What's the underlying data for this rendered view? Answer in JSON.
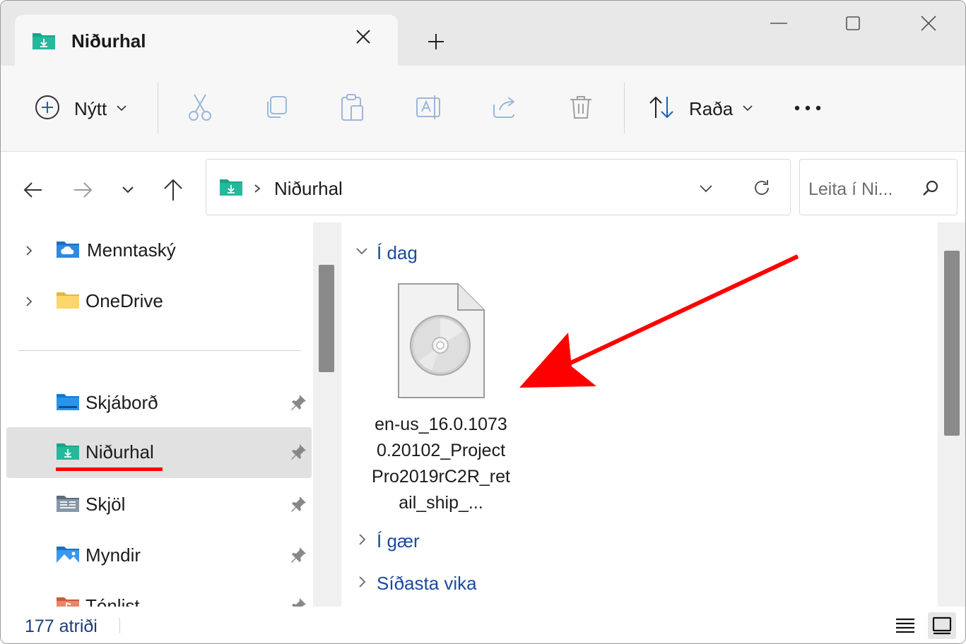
{
  "tab": {
    "title": "Niðurhal",
    "new_tab": "+"
  },
  "window_controls": {
    "minimize": "minimize",
    "maximize": "maximize",
    "close": "close"
  },
  "toolbar": {
    "new_label": "Nýtt",
    "sort_label": "Raða",
    "actions": [
      "cut",
      "copy",
      "paste",
      "rename",
      "share",
      "delete"
    ],
    "more": "•••"
  },
  "address": {
    "path": "Niðurhal",
    "separator": "›"
  },
  "search": {
    "placeholder": "Leita í Ni..."
  },
  "nav": {
    "items": [
      {
        "label": "Menntaský",
        "icon": "cloud-folder-icon",
        "expandable": true
      },
      {
        "label": "OneDrive",
        "icon": "folder-icon",
        "expandable": true
      },
      {
        "label": "Skjáborð",
        "icon": "desktop-folder-icon",
        "pinned": true
      },
      {
        "label": "Niðurhal",
        "icon": "downloads-folder-icon",
        "pinned": true,
        "selected": true
      },
      {
        "label": "Skjöl",
        "icon": "documents-folder-icon",
        "pinned": true
      },
      {
        "label": "Myndir",
        "icon": "pictures-folder-icon",
        "pinned": true
      },
      {
        "label": "Tónlist",
        "icon": "music-folder-icon",
        "pinned": true
      }
    ]
  },
  "content": {
    "groups": [
      {
        "label": "Í dag",
        "expanded": true
      },
      {
        "label": "Í gær",
        "expanded": false
      },
      {
        "label": "Síðasta vika",
        "expanded": false
      }
    ],
    "file": {
      "name": "en-us_16.0.10730.20102_ProjectPro2019rC2R_retail_ship_...",
      "icon": "disc-image-icon"
    }
  },
  "status": {
    "item_count": "177 atriði"
  },
  "colors": {
    "accent": "#1c4aa0",
    "annotation": "#ff0000",
    "folder_teal": "#1aa38a"
  }
}
